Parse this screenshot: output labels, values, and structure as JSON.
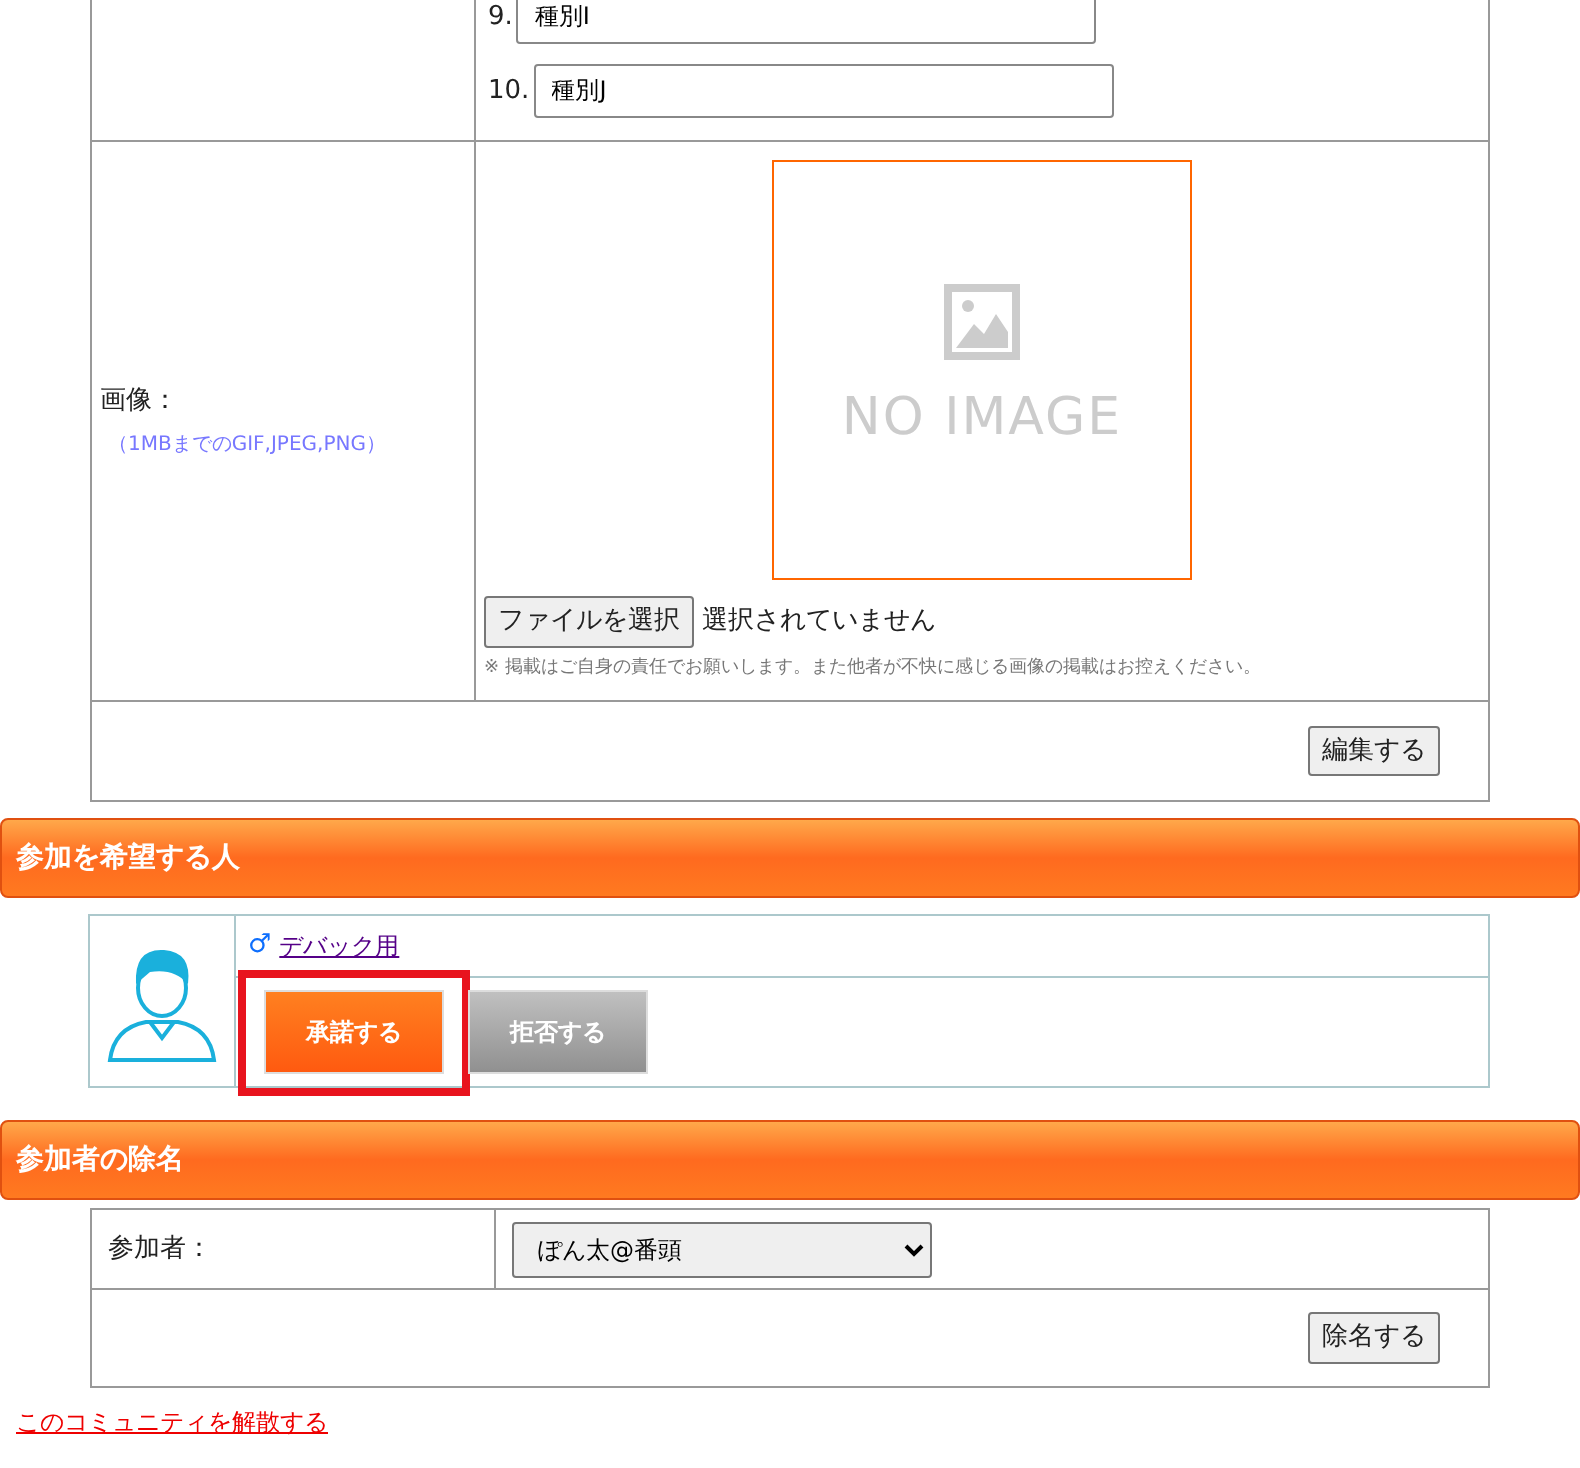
{
  "kind_fields": [
    {
      "number": "9.",
      "value": "種別I"
    },
    {
      "number": "10.",
      "value": "種別J"
    }
  ],
  "image_row": {
    "label": "画像：",
    "hint": "（1MBまでのGIF,JPEG,PNG）",
    "preview_text": "NO IMAGE",
    "file_button": "ファイルを選択",
    "file_status": "選択されていません",
    "note": "※ 掲載はご自身の責任でお願いします。また他者が不快に感じる画像の掲載はお控えください。"
  },
  "edit_button": "編集する",
  "applicants_section": {
    "title": "参加を希望する人",
    "applicants": [
      {
        "gender_mark": "♂",
        "name": "デバック用",
        "accept": {
          "label": "承諾する",
          "highlighted": true
        },
        "reject": {
          "label": "拒否する"
        }
      }
    ]
  },
  "remove_section": {
    "title": "参加者の除名",
    "label": "参加者：",
    "selected_member": "ぽん太@番頭",
    "button": "除名する"
  },
  "dissolve_link": "このコミュニティを解散する"
}
